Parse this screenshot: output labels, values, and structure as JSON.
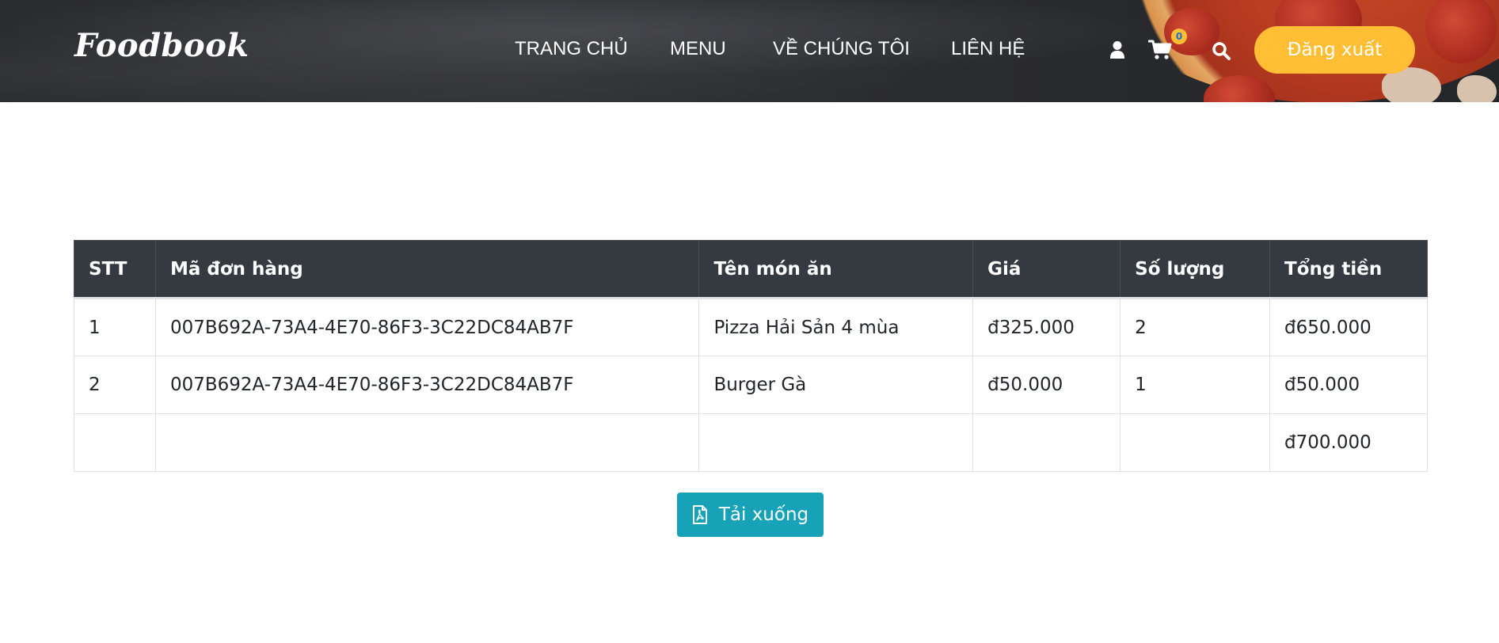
{
  "brand": {
    "logo_text": "Foodbook"
  },
  "nav": {
    "items": [
      {
        "label": "TRANG CHỦ"
      },
      {
        "label": "MENU"
      },
      {
        "label": "VỀ CHÚNG TÔI"
      },
      {
        "label": "LIÊN HỆ"
      }
    ]
  },
  "header_icons": {
    "user": "user-icon",
    "cart": "cart-icon",
    "cart_count": "0",
    "search": "search-icon"
  },
  "auth": {
    "logout_label": "Đăng xuất"
  },
  "colors": {
    "accent": "#ffbe33",
    "table_header": "#343a40",
    "download_button": "#17a2b8"
  },
  "orders_table": {
    "headers": [
      "STT",
      "Mã đơn hàng",
      "Tên món ăn",
      "Giá",
      "Số lượng",
      "Tổng tiền"
    ],
    "rows": [
      [
        "1",
        "007B692A-73A4-4E70-86F3-3C22DC84AB7F",
        "Pizza Hải Sản 4 mùa",
        "đ325.000",
        "2",
        "đ650.000"
      ],
      [
        "2",
        "007B692A-73A4-4E70-86F3-3C22DC84AB7F",
        "Burger Gà",
        "đ50.000",
        "1",
        "đ50.000"
      ]
    ],
    "total_row": [
      "",
      "",
      "",
      "",
      "",
      "đ700.000"
    ]
  },
  "actions": {
    "download_label": "Tải xuống",
    "download_icon": "file-pdf-icon"
  }
}
